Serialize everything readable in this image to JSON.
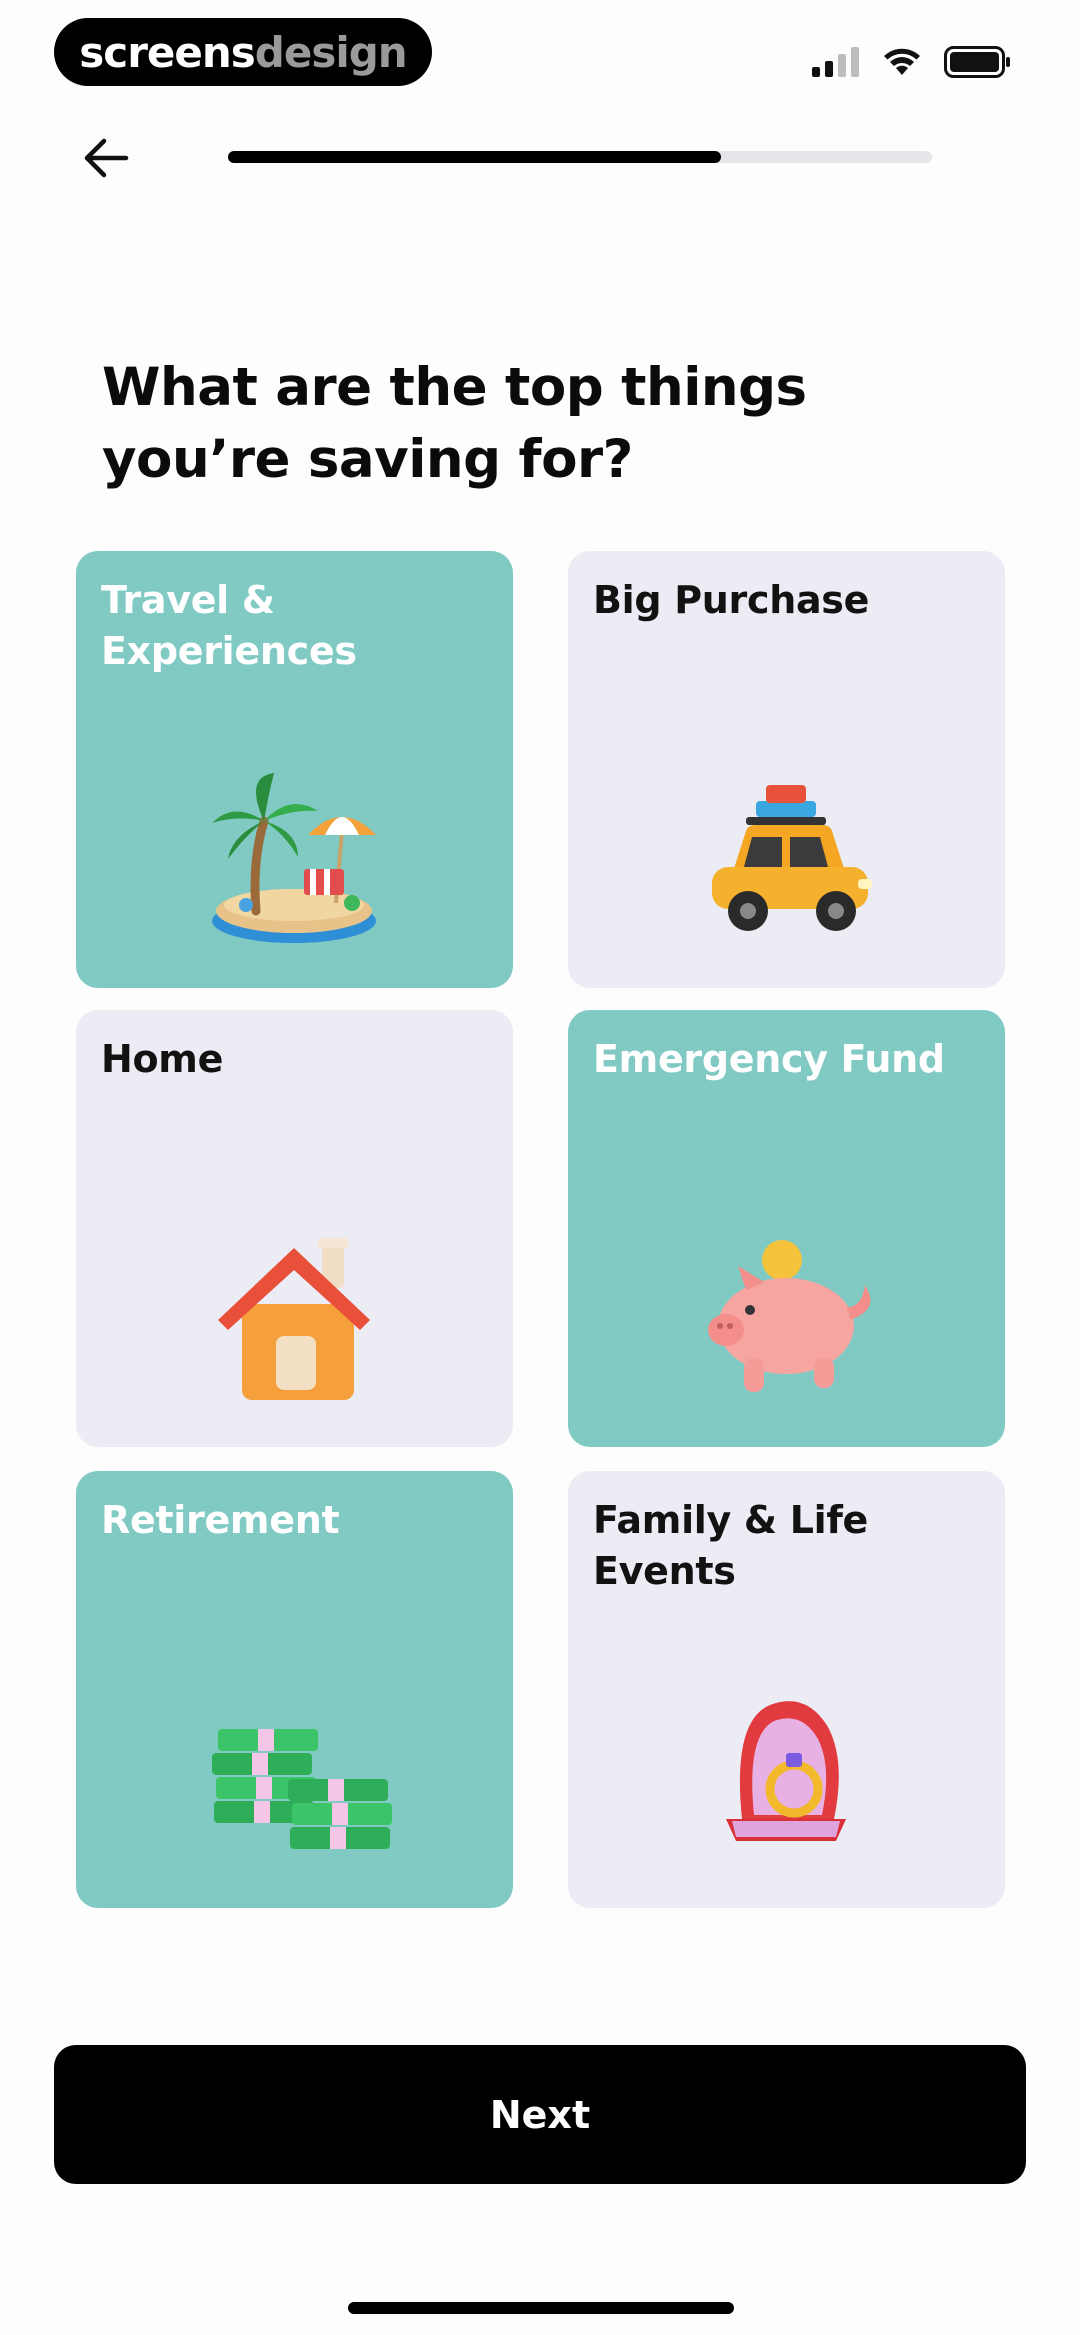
{
  "status_bar": {
    "brand_part1": "screens",
    "brand_part2": "design",
    "icons": [
      "cellular-signal-icon",
      "wifi-icon",
      "battery-icon"
    ]
  },
  "nav": {
    "back_icon": "arrow-left-icon",
    "progress_fraction": 0.7
  },
  "title": "What are the top things you’re saving for?",
  "options": [
    {
      "label": "Travel & Experiences",
      "selected": true,
      "icon": "beach-island-icon"
    },
    {
      "label": "Big Purchase",
      "selected": false,
      "icon": "car-with-luggage-icon"
    },
    {
      "label": "Home",
      "selected": false,
      "icon": "house-icon"
    },
    {
      "label": "Emergency Fund",
      "selected": true,
      "icon": "piggy-bank-icon"
    },
    {
      "label": "Retirement",
      "selected": true,
      "icon": "money-stacks-icon"
    },
    {
      "label": "Family & Life Events",
      "selected": false,
      "icon": "ring-box-icon"
    }
  ],
  "next_label": "Next",
  "colors": {
    "selected_tile": "#81cac4",
    "unselected_tile": "#ececf4",
    "button": "#000000"
  }
}
